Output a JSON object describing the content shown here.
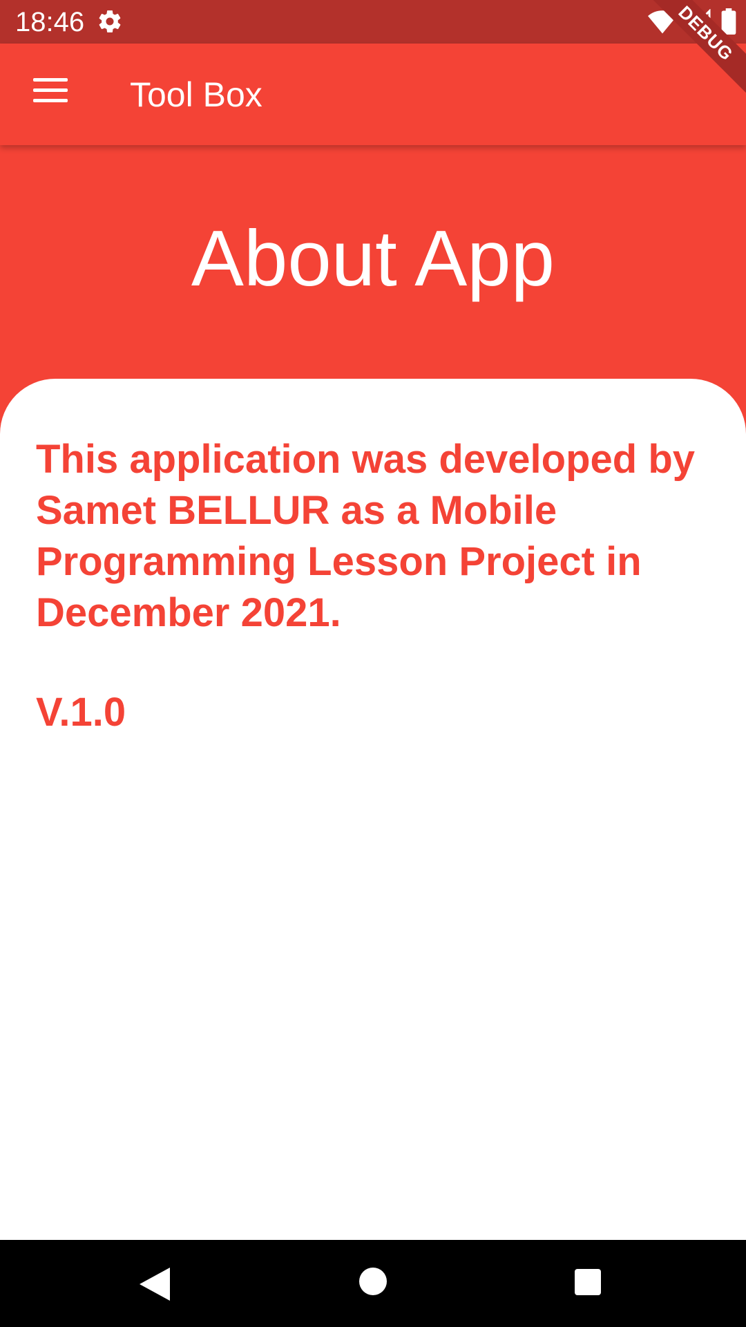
{
  "status_bar": {
    "time": "18:46",
    "left_icons": [
      "gear-icon"
    ],
    "right_icons": [
      "wifi-icon",
      "cell-signal-icon",
      "battery-icon"
    ],
    "color": "#b3312b"
  },
  "app_bar": {
    "title": "Tool Box",
    "menu_icon": "menu-icon",
    "color": "#f44336"
  },
  "debug_banner": {
    "label": "DEBUG"
  },
  "header": {
    "title": "About App"
  },
  "content": {
    "about_text": "This application was developed by Samet BELLUR as a Mobile Programming Lesson Project in December 2021.",
    "version": "V.1.0",
    "text_color": "#f44336"
  },
  "nav_bar": {
    "icons": [
      "back-icon",
      "home-icon",
      "recents-icon"
    ]
  }
}
